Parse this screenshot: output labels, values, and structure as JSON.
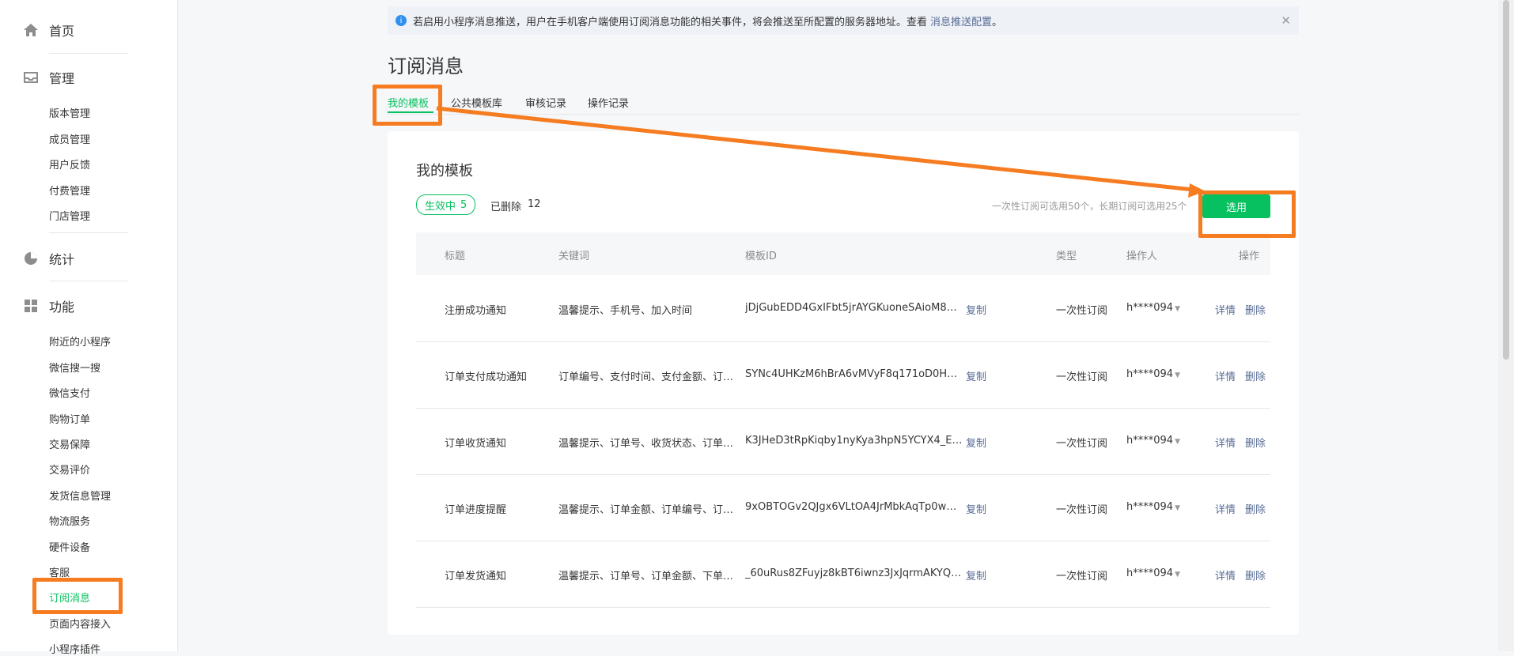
{
  "sidebar": {
    "home": "首页",
    "manage": "管理",
    "manage_items": [
      "版本管理",
      "成员管理",
      "用户反馈",
      "付费管理",
      "门店管理"
    ],
    "stats": "统计",
    "features": "功能",
    "feature_items": [
      "附近的小程序",
      "微信搜一搜",
      "微信支付",
      "购物订单",
      "交易保障",
      "交易评价",
      "发货信息管理",
      "物流服务",
      "硬件设备",
      "客服",
      "订阅消息",
      "页面内容接入",
      "小程序插件"
    ]
  },
  "notice": {
    "text": "若启用小程序消息推送，用户在手机客户端使用订阅消息功能的相关事件，将会推送至所配置的服务器地址。查看",
    "link": "消息推送配置",
    "end": "。"
  },
  "page": {
    "title": "订阅消息",
    "tabs": [
      "我的模板",
      "公共模板库",
      "审核记录",
      "操作记录"
    ]
  },
  "card": {
    "title": "我的模板",
    "active_label": "生效中",
    "active_count": "5",
    "deleted_label": "已删除",
    "deleted_count": "12",
    "limit_tip": "一次性订阅可选用50个，长期订阅可选用25个",
    "select_button": "选用"
  },
  "table": {
    "headers": [
      "标题",
      "关键词",
      "模板ID",
      "类型",
      "操作人",
      "操作"
    ],
    "copy": "复制",
    "detail": "详情",
    "delete": "删除",
    "rows": [
      {
        "title": "注册成功通知",
        "keywords": "温馨提示、手机号、加入时间",
        "id": "jDjGubEDD4GxIFbt5jrAYGKuoneSAioM8pw...",
        "type": "一次性订阅",
        "operator": "h****094"
      },
      {
        "title": "订单支付成功通知",
        "keywords": "订单编号、支付时间、支付金额、订单...",
        "id": "SYNc4UHKzM6hBrA6vMVyF8q171oD0HnH...",
        "type": "一次性订阅",
        "operator": "h****094"
      },
      {
        "title": "订单收货通知",
        "keywords": "温馨提示、订单号、收货状态、订单数...",
        "id": "K3JHeD3tRpKiqby1nyKya3hpN5YCYX4_EL0...",
        "type": "一次性订阅",
        "operator": "h****094"
      },
      {
        "title": "订单进度提醒",
        "keywords": "温馨提示、订单金额、订单编号、订单...",
        "id": "9xOBTOGv2QJgx6VLtOA4JrMbkAqTp0wm2...",
        "type": "一次性订阅",
        "operator": "h****094"
      },
      {
        "title": "订单发货通知",
        "keywords": "温馨提示、订单号、订单金额、下单时...",
        "id": "_60uRus8ZFuyjz8kBT6iwnz3JxJqrmAKYQxX...",
        "type": "一次性订阅",
        "operator": "h****094"
      }
    ]
  },
  "colors": {
    "accent": "#07c160",
    "link": "#576b95",
    "annotation": "#f57c20"
  }
}
